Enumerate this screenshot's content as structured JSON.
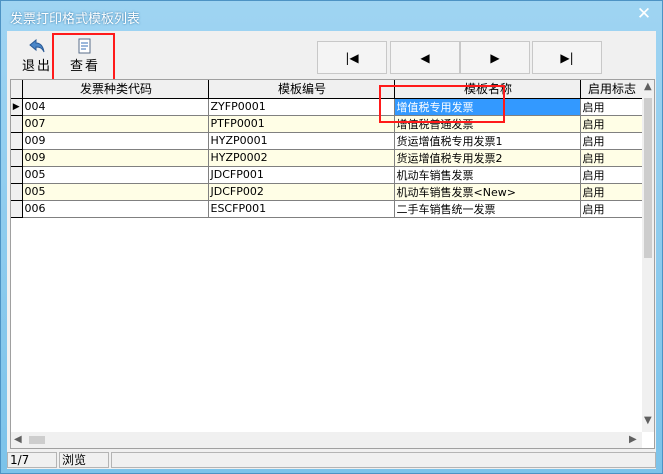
{
  "window": {
    "title": "发票打印格式模板列表",
    "close_glyph": "✕"
  },
  "toolbar": {
    "exit_label": "退出",
    "view_label": "查看",
    "nav": [
      {
        "name": "first-record-button",
        "glyph": "|◀"
      },
      {
        "name": "prev-record-button",
        "glyph": "◀"
      },
      {
        "name": "next-record-button",
        "glyph": "▶"
      },
      {
        "name": "last-record-button",
        "glyph": "▶|"
      }
    ]
  },
  "grid": {
    "columns": [
      "发票种类代码",
      "模板编号",
      "模板名称",
      "启用标志"
    ],
    "rows": [
      [
        "004",
        "ZYFP0001",
        "增值税专用发票",
        "启用"
      ],
      [
        "007",
        "PTFP0001",
        "增值税普通发票",
        "启用"
      ],
      [
        "009",
        "HYZP0001",
        "货运增值税专用发票1",
        "启用"
      ],
      [
        "009",
        "HYZP0002",
        "货运增值税专用发票2",
        "启用"
      ],
      [
        "005",
        "JDCFP001",
        "机动车销售发票",
        "启用"
      ],
      [
        "005",
        "JDCFP002",
        "机动车销售发票<New>",
        "启用"
      ],
      [
        "006",
        "ESCFP001",
        "二手车销售统一发票",
        "启用"
      ]
    ],
    "current_row": 0,
    "selected_cell": [
      0,
      2
    ]
  },
  "status": {
    "position": "1/7",
    "mode": "浏览"
  },
  "colors": {
    "accent_box": "#ff1a1a",
    "selection": "#3399ff",
    "row_alt": "#fffee6"
  }
}
